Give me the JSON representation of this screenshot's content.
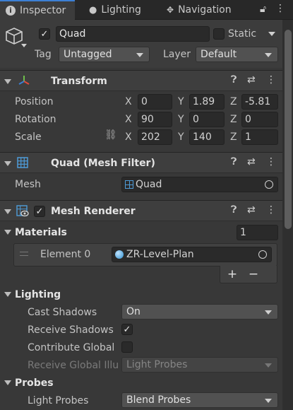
{
  "tabs": [
    {
      "label": "Inspector",
      "icon": "info-icon"
    },
    {
      "label": "Lighting",
      "icon": "lightbulb-icon"
    },
    {
      "label": "Navigation",
      "icon": "navigation-icon"
    }
  ],
  "object": {
    "name": "Quad",
    "active": true,
    "static_label": "Static",
    "static": false,
    "tag_label": "Tag",
    "tag_value": "Untagged",
    "layer_label": "Layer",
    "layer_value": "Default"
  },
  "transform": {
    "title": "Transform",
    "rows": [
      {
        "label": "Position",
        "x": "0",
        "y": "1.89",
        "z": "-5.81"
      },
      {
        "label": "Rotation",
        "x": "90",
        "y": "0",
        "z": "0"
      },
      {
        "label": "Scale",
        "x": "202",
        "y": "140",
        "z": "1"
      }
    ],
    "axis": {
      "x": "X",
      "y": "Y",
      "z": "Z"
    }
  },
  "mesh_filter": {
    "title": "Quad (Mesh Filter)",
    "mesh_label": "Mesh",
    "mesh_value": "Quad"
  },
  "mesh_renderer": {
    "title": "Mesh Renderer",
    "enabled": true,
    "materials_label": "Materials",
    "materials_count": "1",
    "element_label": "Element 0",
    "element_value": "ZR-Level-Plan",
    "add_label": "+",
    "remove_label": "−",
    "lighting_label": "Lighting",
    "cast_shadows_label": "Cast Shadows",
    "cast_shadows_value": "On",
    "receive_shadows_label": "Receive Shadows",
    "receive_shadows": true,
    "contribute_gi_label": "Contribute Global",
    "contribute_gi": false,
    "receive_gi_label": "Receive Global Illu",
    "receive_gi_value": "Light Probes",
    "probes_label": "Probes",
    "light_probes_label": "Light Probes",
    "light_probes_value": "Blend Probes"
  },
  "colors": {
    "accent": "#3c7fd4",
    "panel": "#383838",
    "header": "#3e3e3e"
  }
}
